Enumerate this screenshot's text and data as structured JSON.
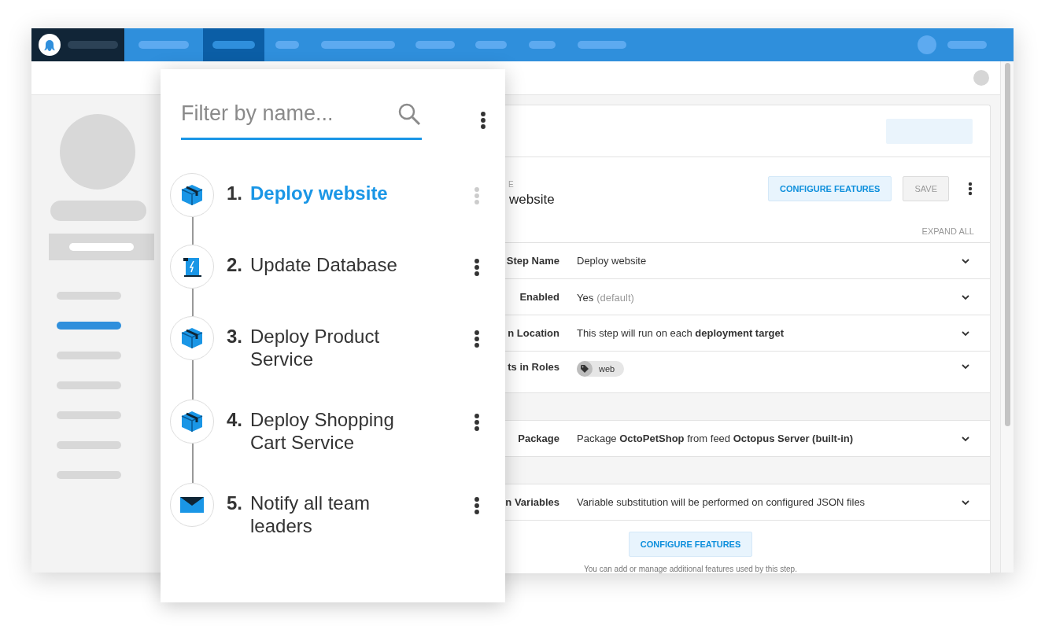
{
  "nav": {
    "tabs": [
      {
        "selected": false
      },
      {
        "selected": true
      },
      {
        "selected": false
      },
      {
        "selected": false
      },
      {
        "selected": false
      },
      {
        "selected": false
      },
      {
        "selected": false
      },
      {
        "selected": false
      }
    ]
  },
  "sidebar": {
    "items": [
      {
        "selected": false
      },
      {
        "selected": true
      },
      {
        "selected": false
      },
      {
        "selected": false
      },
      {
        "selected": false
      },
      {
        "selected": false
      },
      {
        "selected": false
      }
    ]
  },
  "step_editor": {
    "overline": "E",
    "title": "website",
    "buttons": [
      {
        "label": "CONFIGURE FEATURES",
        "kind": "primary",
        "disabled": false
      },
      {
        "label": "SAVE",
        "kind": "secondary",
        "disabled": true
      }
    ],
    "expand_all": "EXPAND ALL",
    "fields": [
      {
        "kind": "field",
        "label": "Step Name",
        "value": "Deploy website"
      },
      {
        "kind": "field",
        "label": "Enabled",
        "value": "Yes",
        "note": "(default)"
      },
      {
        "kind": "field",
        "label": "n Location",
        "value": "This step will run on each **deployment target**"
      },
      {
        "kind": "chips",
        "label": "ts in Roles",
        "chips": [
          "web"
        ]
      },
      {
        "kind": "band"
      },
      {
        "kind": "field",
        "label": "Package",
        "value": "Package **OctoPetShop** from feed **Octopus Server (built-in)**"
      },
      {
        "kind": "band"
      },
      {
        "kind": "field",
        "label": "n Variables",
        "value": "Variable substitution will be performed on configured JSON files"
      }
    ],
    "footer": {
      "button": "CONFIGURE FEATURES",
      "hint": "You can add or manage additional features used by this step."
    }
  },
  "steps_panel": {
    "filter": {
      "placeholder": "Filter by name..."
    },
    "steps": [
      {
        "number": "1.",
        "name": "Deploy website",
        "kind": "package",
        "selected": true
      },
      {
        "number": "2.",
        "name": "Update Database",
        "kind": "script",
        "selected": false
      },
      {
        "number": "3.",
        "name": "Deploy Product Service",
        "kind": "package",
        "selected": false
      },
      {
        "number": "4.",
        "name": "Deploy Shopping Cart Service",
        "kind": "package",
        "selected": false
      },
      {
        "number": "5.",
        "name": "Notify all team leaders",
        "kind": "email",
        "selected": false
      }
    ]
  }
}
